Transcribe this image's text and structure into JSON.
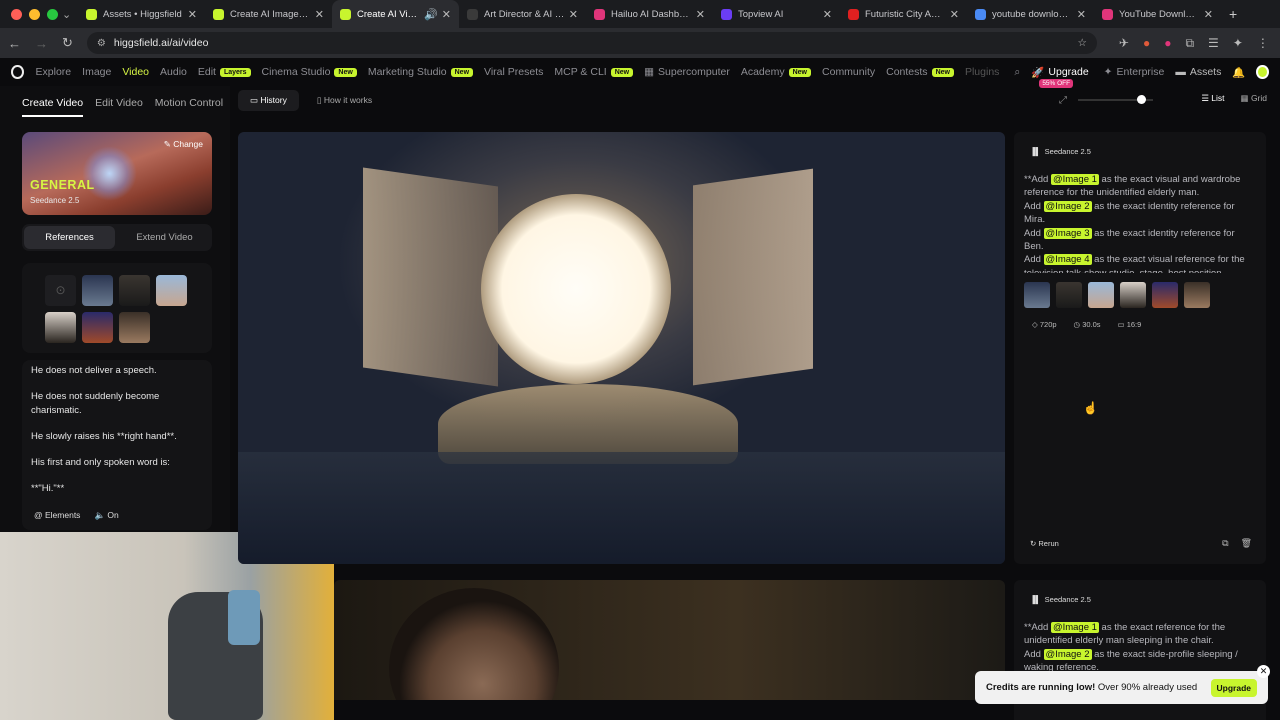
{
  "browser": {
    "tabs": [
      {
        "label": "Assets • Higgsfield",
        "color": "#c8f52e"
      },
      {
        "label": "Create AI Images fro",
        "color": "#c8f52e"
      },
      {
        "label": "Create AI Videos",
        "color": "#c8f52e",
        "active": true
      },
      {
        "label": "Art Director & AI Cre",
        "color": "#3a3a3a"
      },
      {
        "label": "Hailuo AI Dashboard",
        "color": "#e0357a"
      },
      {
        "label": "Topview AI",
        "color": "#6b3df5"
      },
      {
        "label": "Futuristic City Ambie",
        "color": "#e02020"
      },
      {
        "label": "youtube download o",
        "color": "#4a8af4"
      },
      {
        "label": "YouTube Downloader",
        "color": "#e0357a"
      }
    ],
    "url": "higgsfield.ai/ai/video"
  },
  "nav": {
    "items": [
      {
        "label": "Explore"
      },
      {
        "label": "Image"
      },
      {
        "label": "Video",
        "active": true
      },
      {
        "label": "Audio"
      },
      {
        "label": "Edit",
        "badge": "Layers"
      },
      {
        "label": "Cinema Studio",
        "badge": "New"
      },
      {
        "label": "Marketing Studio",
        "badge": "New"
      },
      {
        "label": "Viral Presets"
      },
      {
        "label": "MCP & CLI",
        "badge": "New"
      },
      {
        "label": "Supercomputer"
      },
      {
        "label": "Academy",
        "badge": "New"
      },
      {
        "label": "Community"
      },
      {
        "label": "Contests",
        "badge": "New"
      },
      {
        "label": "Plugins"
      }
    ],
    "upgrade": "Upgrade",
    "upgrade_badge": "55% OFF",
    "enterprise": "Enterprise",
    "assets": "Assets"
  },
  "left": {
    "tabs": [
      "Create Video",
      "Edit Video",
      "Motion Control"
    ],
    "hero_title": "GENERAL",
    "hero_model": "Seedance 2.5",
    "change": "Change",
    "segments": [
      "References",
      "Extend Video"
    ],
    "prompt_lines": [
      "He does not deliver a speech.",
      "He does not suddenly become charismatic.",
      "He slowly raises his **right hand**.",
      "His first and only spoken word is:",
      "**\"Hi.\"**"
    ],
    "elements": "Elements",
    "audio": "On"
  },
  "toolbar": {
    "history": "History",
    "how": "How it works",
    "list": "List",
    "grid": "Grid"
  },
  "card1": {
    "model": "Seedance 2.5",
    "prompt": [
      {
        "pre": "**Add ",
        "tag": "@Image 1",
        "post": " as the exact visual and wardrobe reference for the unidentified elderly man."
      },
      {
        "pre": "Add ",
        "tag": "@Image 2",
        "post": " as the exact identity reference for Mira."
      },
      {
        "pre": "Add ",
        "tag": "@Image 3",
        "post": " as the exact identity reference for Ben."
      },
      {
        "pre": "Add ",
        "tag": "@Image 4",
        "post": " as the exact visual reference for the television talk-show studio, stage, host position"
      }
    ],
    "resolution": "720p",
    "duration": "30.0s",
    "ratio": "16:9",
    "rerun": "Rerun"
  },
  "card2": {
    "model": "Seedance 2.5",
    "prompt": [
      {
        "pre": "**Add ",
        "tag": "@Image 1",
        "post": " as the exact reference for the unidentified elderly man sleeping in the chair."
      },
      {
        "pre": "Add ",
        "tag": "@Image 2",
        "post": " as the exact side-profile sleeping / waking reference."
      }
    ]
  },
  "toast": {
    "bold": "Credits are running low!",
    "rest": " Over 90% already used",
    "button": "Upgrade"
  }
}
